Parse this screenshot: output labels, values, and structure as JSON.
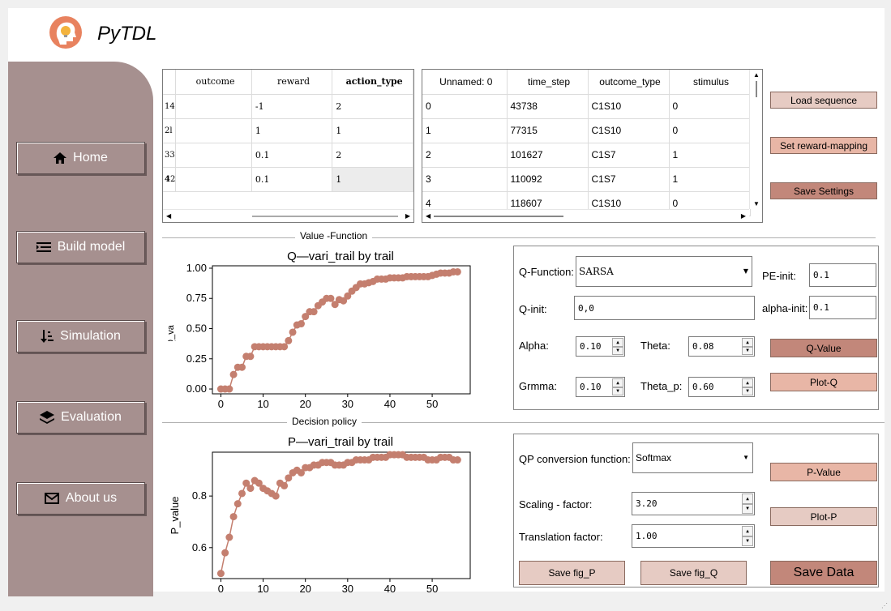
{
  "app": {
    "title": "PyTDL"
  },
  "nav": [
    {
      "label": "Home",
      "icon": "home-icon"
    },
    {
      "label": "Build model",
      "icon": "list-icon"
    },
    {
      "label": "Simulation",
      "icon": "sort-icon"
    },
    {
      "label": "Evaluation",
      "icon": "layers-icon"
    },
    {
      "label": "About us",
      "icon": "mail-icon"
    }
  ],
  "table1": {
    "row_headers": [
      "1",
      "2",
      "3",
      "4"
    ],
    "first_col": [
      "4",
      "l",
      "3",
      "2"
    ],
    "columns": [
      "outcome",
      "reward",
      "action_type"
    ],
    "rows": [
      [
        "-1",
        "2"
      ],
      [
        "1",
        "1"
      ],
      [
        "0.1",
        "2"
      ],
      [
        "0.1",
        "1"
      ]
    ]
  },
  "table2": {
    "columns": [
      "Unnamed: 0",
      "time_step",
      "outcome_type",
      "stimulus"
    ],
    "rows": [
      [
        "0",
        "43738",
        "C1S10",
        "0"
      ],
      [
        "1",
        "77315",
        "C1S10",
        "0"
      ],
      [
        "2",
        "101627",
        "C1S7",
        "1"
      ],
      [
        "3",
        "110092",
        "C1S7",
        "1"
      ],
      [
        "4",
        "118607",
        "C1S10",
        "0"
      ]
    ]
  },
  "buttons": {
    "load": "Load sequence",
    "reward": "Set reward-mapping",
    "save_settings": "Save Settings",
    "qvalue": "Q-Value",
    "plotq": "Plot-Q",
    "pvalue": "P-Value",
    "plotp": "Plot-P",
    "save_fig_p": "Save fig_P",
    "save_fig_q": "Save fig_Q",
    "save_data": "Save Data"
  },
  "sections": {
    "value_function": "Value -Function",
    "decision_policy": "Decision policy"
  },
  "qpanel": {
    "qfunction_label": "Q-Function:",
    "qfunction_value": "SARSA",
    "peinit_label": "PE-init:",
    "peinit_value": "0.1",
    "qinit_label": "Q-init:",
    "qinit_value": "0,0",
    "alphainit_label": "alpha-init:",
    "alphainit_value": "0.1",
    "alpha_label": "Alpha:",
    "alpha_value": "0.10",
    "theta_label": "Theta:",
    "theta_value": "0.08",
    "gamma_label": "Grmma:",
    "gamma_value": "0.10",
    "thetap_label": "Theta_p:",
    "thetap_value": "0.60"
  },
  "ppanel": {
    "conv_label": "QP conversion function:",
    "conv_value": "Softmax",
    "scale_label": "Scaling  -  factor:",
    "scale_value": "3.20",
    "trans_label": "Translation factor:",
    "trans_value": "1.00"
  },
  "colors": {
    "sidebar": "#a6908f",
    "marker": "#c47f6f"
  },
  "chart_data": [
    {
      "type": "line",
      "title": "Q—vari_trail by trail",
      "xlabel": "",
      "ylabel": "Q_value",
      "xlim": [
        -2,
        59
      ],
      "ylim": [
        -0.04,
        1.02
      ],
      "xticks": [
        0,
        10,
        20,
        30,
        40,
        50
      ],
      "yticks": [
        0.0,
        0.25,
        0.5,
        0.75,
        1.0
      ],
      "ytick_labels": [
        "0.00",
        "0.25",
        "0.50",
        "0.75",
        "1.00"
      ],
      "x": [
        0,
        1,
        2,
        3,
        4,
        5,
        6,
        7,
        8,
        9,
        10,
        11,
        12,
        13,
        14,
        15,
        16,
        17,
        18,
        19,
        20,
        21,
        22,
        23,
        24,
        25,
        26,
        27,
        28,
        29,
        30,
        31,
        32,
        33,
        34,
        35,
        36,
        37,
        38,
        39,
        40,
        41,
        42,
        43,
        44,
        45,
        46,
        47,
        48,
        49,
        50,
        51,
        52,
        53,
        54,
        55,
        56
      ],
      "y": [
        0,
        0,
        0,
        0.12,
        0.18,
        0.18,
        0.27,
        0.27,
        0.35,
        0.35,
        0.35,
        0.35,
        0.35,
        0.35,
        0.35,
        0.35,
        0.4,
        0.47,
        0.53,
        0.54,
        0.6,
        0.64,
        0.64,
        0.69,
        0.72,
        0.75,
        0.75,
        0.7,
        0.74,
        0.73,
        0.77,
        0.81,
        0.84,
        0.87,
        0.87,
        0.88,
        0.89,
        0.91,
        0.91,
        0.91,
        0.92,
        0.92,
        0.92,
        0.92,
        0.93,
        0.93,
        0.93,
        0.93,
        0.93,
        0.93,
        0.94,
        0.95,
        0.96,
        0.96,
        0.96,
        0.97,
        0.97
      ]
    },
    {
      "type": "line",
      "title": "P—vari_trail by trail",
      "xlabel": "",
      "ylabel": "P_value",
      "xlim": [
        -2,
        59
      ],
      "ylim": [
        0.48,
        0.97
      ],
      "xticks": [
        0,
        10,
        20,
        30,
        40,
        50
      ],
      "yticks": [
        0.6,
        0.8
      ],
      "ytick_labels": [
        "0.6",
        "0.8"
      ],
      "x": [
        0,
        1,
        2,
        3,
        4,
        5,
        6,
        7,
        8,
        9,
        10,
        11,
        12,
        13,
        14,
        15,
        16,
        17,
        18,
        19,
        20,
        21,
        22,
        23,
        24,
        25,
        26,
        27,
        28,
        29,
        30,
        31,
        32,
        33,
        34,
        35,
        36,
        37,
        38,
        39,
        40,
        41,
        42,
        43,
        44,
        45,
        46,
        47,
        48,
        49,
        50,
        51,
        52,
        53,
        54,
        55,
        56
      ],
      "y": [
        0.5,
        0.58,
        0.64,
        0.72,
        0.77,
        0.81,
        0.85,
        0.83,
        0.86,
        0.85,
        0.83,
        0.82,
        0.81,
        0.8,
        0.85,
        0.84,
        0.87,
        0.89,
        0.9,
        0.89,
        0.91,
        0.91,
        0.92,
        0.92,
        0.93,
        0.93,
        0.93,
        0.92,
        0.92,
        0.92,
        0.93,
        0.93,
        0.94,
        0.94,
        0.94,
        0.94,
        0.95,
        0.95,
        0.95,
        0.95,
        0.96,
        0.96,
        0.96,
        0.96,
        0.95,
        0.95,
        0.95,
        0.95,
        0.95,
        0.94,
        0.94,
        0.94,
        0.95,
        0.95,
        0.95,
        0.94,
        0.94
      ]
    }
  ]
}
